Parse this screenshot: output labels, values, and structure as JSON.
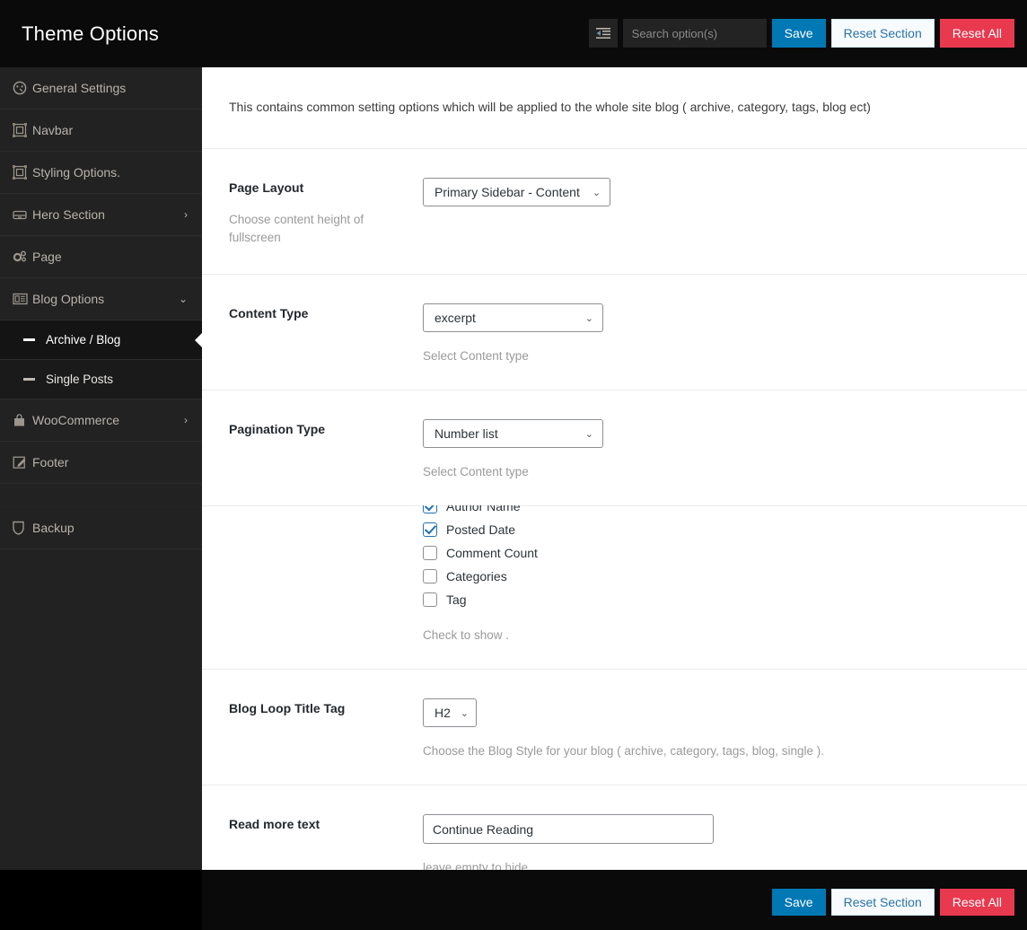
{
  "header": {
    "title": "Theme Options",
    "toggle_icon": "list-toggle-icon",
    "search": {
      "placeholder": "Search option(s)",
      "value": ""
    },
    "save_label": "Save",
    "reset_section_label": "Reset Section",
    "reset_all_label": "Reset All"
  },
  "colors": {
    "header_bg": "#0a0a0a",
    "sidebar_bg": "#222222",
    "save_blue": "#0078b4",
    "reset_all_red": "#e8394f",
    "reset_section_text": "#2a73a8",
    "checkbox_accent": "#2271b1",
    "content_bg": "#ffffff",
    "divider": "#ececec"
  },
  "sidebar": {
    "items": [
      {
        "label": "General Settings",
        "icon": "dashboard-icon",
        "chevron": "",
        "type": "top"
      },
      {
        "label": "Navbar",
        "icon": "layout-object-icon",
        "chevron": "",
        "type": "top"
      },
      {
        "label": "Styling Options.",
        "icon": "layout-object-icon",
        "chevron": "",
        "type": "top"
      },
      {
        "label": "Hero Section",
        "icon": "drawer-icon",
        "chevron": "›",
        "type": "top"
      },
      {
        "label": "Page",
        "icon": "gears-icon",
        "chevron": "",
        "type": "top"
      },
      {
        "label": "Blog Options",
        "icon": "newspaper-icon",
        "chevron": "⌄",
        "type": "top"
      },
      {
        "label": "Archive / Blog",
        "icon": "dash-icon",
        "chevron": "",
        "type": "sub",
        "active": true
      },
      {
        "label": "Single Posts",
        "icon": "dash-icon",
        "chevron": "",
        "type": "sub",
        "active": false
      },
      {
        "label": "WooCommerce",
        "icon": "shopping-bag-icon",
        "chevron": "›",
        "type": "top"
      },
      {
        "label": "Footer",
        "icon": "edit-square-icon",
        "chevron": "",
        "type": "top"
      },
      {
        "label": "",
        "icon": "",
        "chevron": "",
        "type": "clipped"
      },
      {
        "label": "Backup",
        "icon": "shield-icon",
        "chevron": "",
        "type": "top"
      }
    ]
  },
  "main": {
    "intro": "This contains common setting options which will be applied to the whole site blog ( archive, category, tags, blog ect)",
    "rows": {
      "page_layout": {
        "title": "Page Layout",
        "sub": "Choose content height of fullscreen",
        "select_value": "Primary Sidebar - Content"
      },
      "content_type": {
        "title": "Content Type",
        "select_value": "excerpt",
        "hint": "Select Content type"
      },
      "pagination_type": {
        "title": "Pagination Type",
        "select_value": "Number list",
        "hint": "Select Content type"
      },
      "meta_checks": {
        "clipped_item": {
          "label": "Author Name",
          "checked": true
        },
        "items": [
          {
            "label": "Posted Date",
            "checked": true
          },
          {
            "label": "Comment Count",
            "checked": false
          },
          {
            "label": "Categories",
            "checked": false
          },
          {
            "label": "Tag",
            "checked": false
          }
        ],
        "hint": "Check to show ."
      },
      "blog_loop_title_tag": {
        "title": "Blog Loop Title Tag",
        "select_value": "H2",
        "hint": "Choose the Blog Style for your blog ( archive, category, tags, blog, single )."
      },
      "read_more_text": {
        "title": "Read more text",
        "input_value": "Continue Reading",
        "hint": "leave empty to hide"
      }
    }
  },
  "footer": {
    "save_label": "Save",
    "reset_section_label": "Reset Section",
    "reset_all_label": "Reset All"
  }
}
